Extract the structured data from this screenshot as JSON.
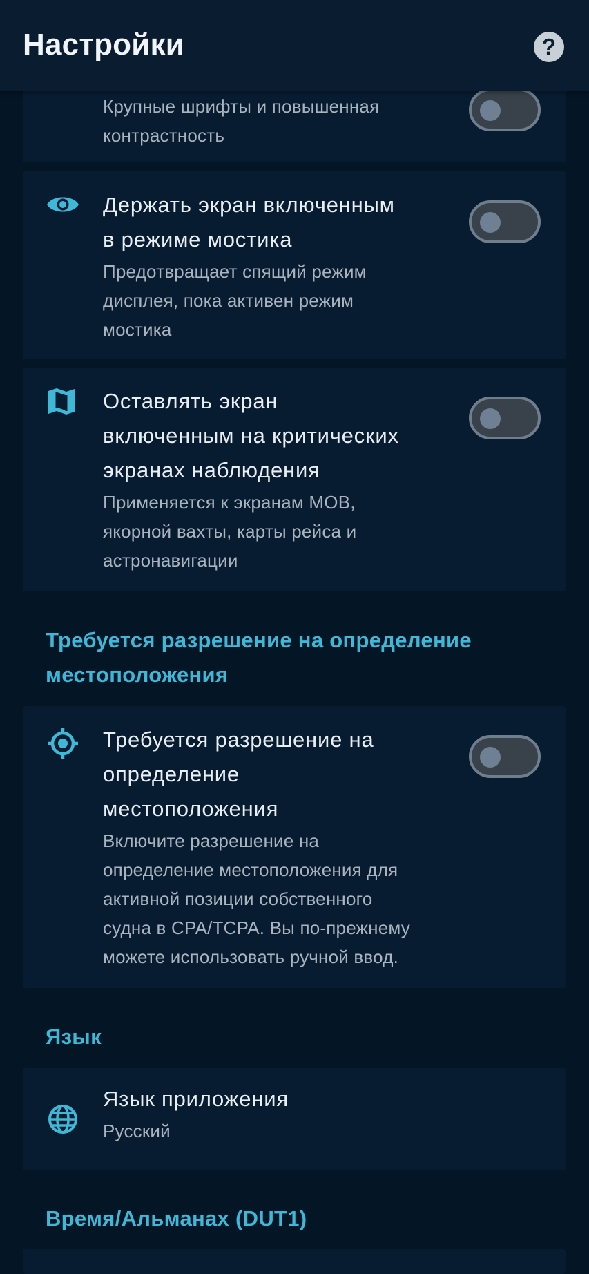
{
  "app_bar": {
    "title": "Настройки",
    "help_icon": "help-circle-icon",
    "help_glyph": "?"
  },
  "settings": [
    {
      "id": "large-fonts",
      "title": "",
      "subtitle_lines": [
        "Крупные шрифты и повышенная",
        "контрастность"
      ],
      "toggle": false
    },
    {
      "id": "keep-screen-bridge",
      "icon": "eye-icon",
      "title_lines": [
        "Держать экран включенным",
        "в режиме мостика"
      ],
      "subtitle_lines": [
        "Предотвращает спящий режим",
        "дисплея, пока активен режим",
        "мостика"
      ],
      "toggle": false
    },
    {
      "id": "keep-screen-critical",
      "icon": "map-icon",
      "title_lines": [
        "Оставлять экран",
        "включенным на критических",
        "экранах наблюдения"
      ],
      "subtitle_lines": [
        "Применяется к экранам MOB,",
        "якорной вахты, карты рейса и",
        "астронавигации"
      ],
      "toggle": false
    }
  ],
  "location_section": {
    "header_lines": [
      "Требуется разрешение на определение",
      "местоположения"
    ],
    "item": {
      "icon": "gps-target-icon",
      "title_lines": [
        "Требуется разрешение на",
        "определение",
        "местоположения"
      ],
      "subtitle_lines": [
        "Включите разрешение на",
        "определение местоположения для",
        "активной позиции собственного",
        "судна в CPA/TCPA. Вы по-прежнему",
        "можете использовать ручной ввод."
      ],
      "toggle": false
    }
  },
  "language_section": {
    "header": "Язык",
    "item": {
      "icon": "globe-icon",
      "title": "Язык приложения",
      "value": "Русский"
    }
  },
  "time_section": {
    "header": "Время/Альманах (DUT1)"
  },
  "colors": {
    "background": "#041526",
    "card": "#081c31",
    "accent": "#3fb8d8",
    "toggle_track": "#39414b",
    "toggle_border": "#6f7e8d"
  }
}
